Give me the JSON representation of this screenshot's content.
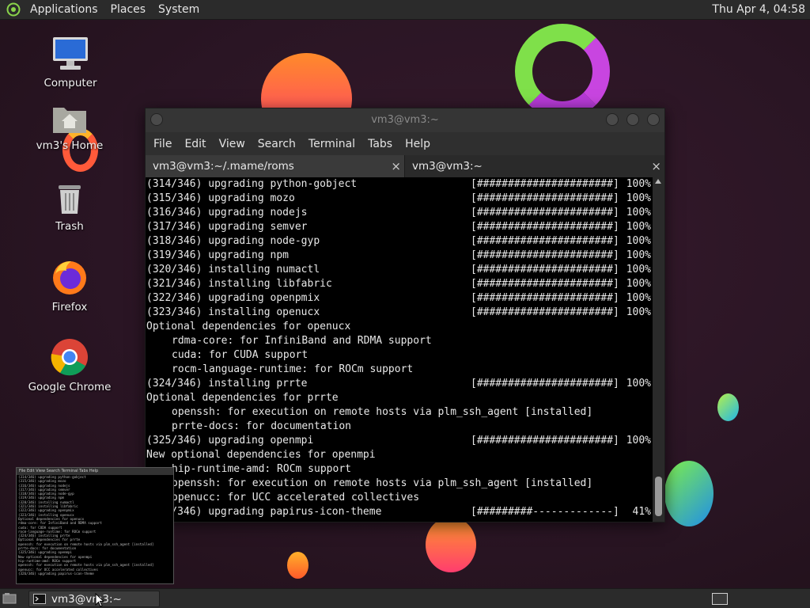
{
  "top_panel": {
    "menus": [
      "Applications",
      "Places",
      "System"
    ],
    "clock": "Thu Apr  4, 04:58",
    "logo_icon": "distro-logo-icon"
  },
  "desktop_icons": [
    {
      "label": "Computer",
      "icon": "computer-icon"
    },
    {
      "label": "vm3's Home",
      "icon": "home-folder-icon"
    },
    {
      "label": "Trash",
      "icon": "trash-icon"
    },
    {
      "label": "Firefox",
      "icon": "firefox-icon"
    },
    {
      "label": "Google Chrome",
      "icon": "chrome-icon"
    }
  ],
  "terminal": {
    "title": "vm3@vm3:~",
    "menus": [
      "File",
      "Edit",
      "View",
      "Search",
      "Terminal",
      "Tabs",
      "Help"
    ],
    "tabs": [
      {
        "label": "vm3@vm3:~/.mame/roms",
        "close": "×"
      },
      {
        "label": "vm3@vm3:~",
        "close": "×"
      }
    ],
    "lines": [
      {
        "text": "(314/346) upgrading python-gobject",
        "bar": "[######################]",
        "pct": "100%"
      },
      {
        "text": "(315/346) upgrading mozo",
        "bar": "[######################]",
        "pct": "100%"
      },
      {
        "text": "(316/346) upgrading nodejs",
        "bar": "[######################]",
        "pct": "100%"
      },
      {
        "text": "(317/346) upgrading semver",
        "bar": "[######################]",
        "pct": "100%"
      },
      {
        "text": "(318/346) upgrading node-gyp",
        "bar": "[######################]",
        "pct": "100%"
      },
      {
        "text": "(319/346) upgrading npm",
        "bar": "[######################]",
        "pct": "100%"
      },
      {
        "text": "(320/346) installing numactl",
        "bar": "[######################]",
        "pct": "100%"
      },
      {
        "text": "(321/346) installing libfabric",
        "bar": "[######################]",
        "pct": "100%"
      },
      {
        "text": "(322/346) upgrading openpmix",
        "bar": "[######################]",
        "pct": "100%"
      },
      {
        "text": "(323/346) installing openucx",
        "bar": "[######################]",
        "pct": "100%"
      },
      {
        "text": "Optional dependencies for openucx",
        "bar": "",
        "pct": ""
      },
      {
        "text": "rdma-core: for InfiniBand and RDMA support",
        "bar": "",
        "pct": "",
        "indent": true
      },
      {
        "text": "cuda: for CUDA support",
        "bar": "",
        "pct": "",
        "indent": true
      },
      {
        "text": "rocm-language-runtime: for ROCm support",
        "bar": "",
        "pct": "",
        "indent": true
      },
      {
        "text": "(324/346) installing prrte",
        "bar": "[######################]",
        "pct": "100%"
      },
      {
        "text": "Optional dependencies for prrte",
        "bar": "",
        "pct": ""
      },
      {
        "text": "openssh: for execution on remote hosts via plm_ssh_agent [installed]",
        "bar": "",
        "pct": "",
        "indent": true
      },
      {
        "text": "prrte-docs: for documentation",
        "bar": "",
        "pct": "",
        "indent": true
      },
      {
        "text": "(325/346) upgrading openmpi",
        "bar": "[######################]",
        "pct": "100%"
      },
      {
        "text": "New optional dependencies for openmpi",
        "bar": "",
        "pct": ""
      },
      {
        "text": "hip-runtime-amd: ROCm support",
        "bar": "",
        "pct": "",
        "indent": true
      },
      {
        "text": "openssh: for execution on remote hosts via plm_ssh_agent [installed]",
        "bar": "",
        "pct": "",
        "indent": true
      },
      {
        "text": "openucc: for UCC accelerated collectives",
        "bar": "",
        "pct": "",
        "indent": true
      },
      {
        "text": "(326/346) upgrading papirus-icon-theme",
        "bar": "[#########-------------]",
        "pct": "41%"
      }
    ]
  },
  "thumbnail": {
    "menus": "File  Edit  View  Search  Terminal  Tabs  Help"
  },
  "taskbar": {
    "item_label": "vm3@vm3:~",
    "show_desktop_icon": "show-desktop-icon",
    "workspace_icon": "workspace-switcher-icon"
  },
  "colors": {
    "terminal_bg": "#000000",
    "panel_bg": "#2b2b2b",
    "desktop_bg": "#2a1524"
  }
}
